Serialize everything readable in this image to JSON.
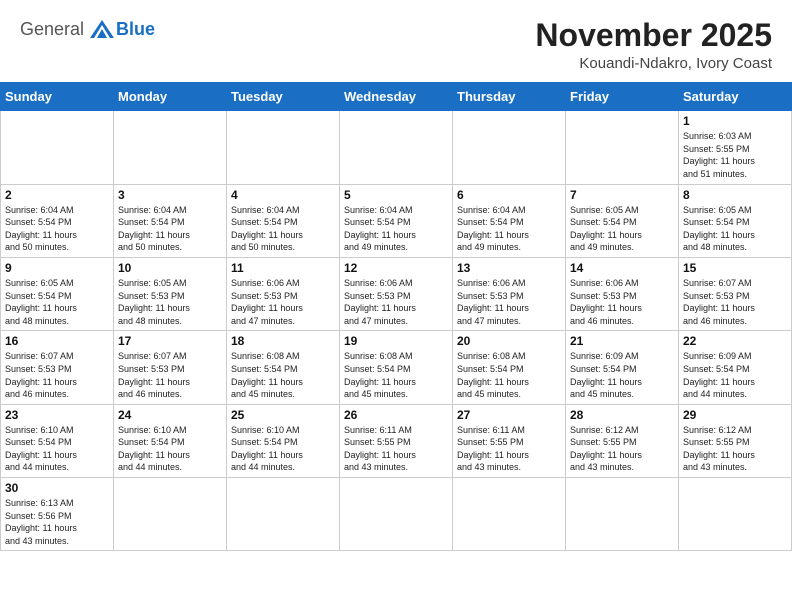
{
  "header": {
    "logo_general": "General",
    "logo_blue": "Blue",
    "month_year": "November 2025",
    "location": "Kouandi-Ndakro, Ivory Coast"
  },
  "weekdays": [
    "Sunday",
    "Monday",
    "Tuesday",
    "Wednesday",
    "Thursday",
    "Friday",
    "Saturday"
  ],
  "weeks": [
    [
      {
        "day": "",
        "info": ""
      },
      {
        "day": "",
        "info": ""
      },
      {
        "day": "",
        "info": ""
      },
      {
        "day": "",
        "info": ""
      },
      {
        "day": "",
        "info": ""
      },
      {
        "day": "",
        "info": ""
      },
      {
        "day": "1",
        "info": "Sunrise: 6:03 AM\nSunset: 5:55 PM\nDaylight: 11 hours\nand 51 minutes."
      }
    ],
    [
      {
        "day": "2",
        "info": "Sunrise: 6:04 AM\nSunset: 5:54 PM\nDaylight: 11 hours\nand 50 minutes."
      },
      {
        "day": "3",
        "info": "Sunrise: 6:04 AM\nSunset: 5:54 PM\nDaylight: 11 hours\nand 50 minutes."
      },
      {
        "day": "4",
        "info": "Sunrise: 6:04 AM\nSunset: 5:54 PM\nDaylight: 11 hours\nand 50 minutes."
      },
      {
        "day": "5",
        "info": "Sunrise: 6:04 AM\nSunset: 5:54 PM\nDaylight: 11 hours\nand 49 minutes."
      },
      {
        "day": "6",
        "info": "Sunrise: 6:04 AM\nSunset: 5:54 PM\nDaylight: 11 hours\nand 49 minutes."
      },
      {
        "day": "7",
        "info": "Sunrise: 6:05 AM\nSunset: 5:54 PM\nDaylight: 11 hours\nand 49 minutes."
      },
      {
        "day": "8",
        "info": "Sunrise: 6:05 AM\nSunset: 5:54 PM\nDaylight: 11 hours\nand 48 minutes."
      }
    ],
    [
      {
        "day": "9",
        "info": "Sunrise: 6:05 AM\nSunset: 5:54 PM\nDaylight: 11 hours\nand 48 minutes."
      },
      {
        "day": "10",
        "info": "Sunrise: 6:05 AM\nSunset: 5:53 PM\nDaylight: 11 hours\nand 48 minutes."
      },
      {
        "day": "11",
        "info": "Sunrise: 6:06 AM\nSunset: 5:53 PM\nDaylight: 11 hours\nand 47 minutes."
      },
      {
        "day": "12",
        "info": "Sunrise: 6:06 AM\nSunset: 5:53 PM\nDaylight: 11 hours\nand 47 minutes."
      },
      {
        "day": "13",
        "info": "Sunrise: 6:06 AM\nSunset: 5:53 PM\nDaylight: 11 hours\nand 47 minutes."
      },
      {
        "day": "14",
        "info": "Sunrise: 6:06 AM\nSunset: 5:53 PM\nDaylight: 11 hours\nand 46 minutes."
      },
      {
        "day": "15",
        "info": "Sunrise: 6:07 AM\nSunset: 5:53 PM\nDaylight: 11 hours\nand 46 minutes."
      }
    ],
    [
      {
        "day": "16",
        "info": "Sunrise: 6:07 AM\nSunset: 5:53 PM\nDaylight: 11 hours\nand 46 minutes."
      },
      {
        "day": "17",
        "info": "Sunrise: 6:07 AM\nSunset: 5:53 PM\nDaylight: 11 hours\nand 46 minutes."
      },
      {
        "day": "18",
        "info": "Sunrise: 6:08 AM\nSunset: 5:54 PM\nDaylight: 11 hours\nand 45 minutes."
      },
      {
        "day": "19",
        "info": "Sunrise: 6:08 AM\nSunset: 5:54 PM\nDaylight: 11 hours\nand 45 minutes."
      },
      {
        "day": "20",
        "info": "Sunrise: 6:08 AM\nSunset: 5:54 PM\nDaylight: 11 hours\nand 45 minutes."
      },
      {
        "day": "21",
        "info": "Sunrise: 6:09 AM\nSunset: 5:54 PM\nDaylight: 11 hours\nand 45 minutes."
      },
      {
        "day": "22",
        "info": "Sunrise: 6:09 AM\nSunset: 5:54 PM\nDaylight: 11 hours\nand 44 minutes."
      }
    ],
    [
      {
        "day": "23",
        "info": "Sunrise: 6:10 AM\nSunset: 5:54 PM\nDaylight: 11 hours\nand 44 minutes."
      },
      {
        "day": "24",
        "info": "Sunrise: 6:10 AM\nSunset: 5:54 PM\nDaylight: 11 hours\nand 44 minutes."
      },
      {
        "day": "25",
        "info": "Sunrise: 6:10 AM\nSunset: 5:54 PM\nDaylight: 11 hours\nand 44 minutes."
      },
      {
        "day": "26",
        "info": "Sunrise: 6:11 AM\nSunset: 5:55 PM\nDaylight: 11 hours\nand 43 minutes."
      },
      {
        "day": "27",
        "info": "Sunrise: 6:11 AM\nSunset: 5:55 PM\nDaylight: 11 hours\nand 43 minutes."
      },
      {
        "day": "28",
        "info": "Sunrise: 6:12 AM\nSunset: 5:55 PM\nDaylight: 11 hours\nand 43 minutes."
      },
      {
        "day": "29",
        "info": "Sunrise: 6:12 AM\nSunset: 5:55 PM\nDaylight: 11 hours\nand 43 minutes."
      }
    ],
    [
      {
        "day": "30",
        "info": "Sunrise: 6:13 AM\nSunset: 5:56 PM\nDaylight: 11 hours\nand 43 minutes."
      },
      {
        "day": "",
        "info": ""
      },
      {
        "day": "",
        "info": ""
      },
      {
        "day": "",
        "info": ""
      },
      {
        "day": "",
        "info": ""
      },
      {
        "day": "",
        "info": ""
      },
      {
        "day": "",
        "info": ""
      }
    ]
  ]
}
